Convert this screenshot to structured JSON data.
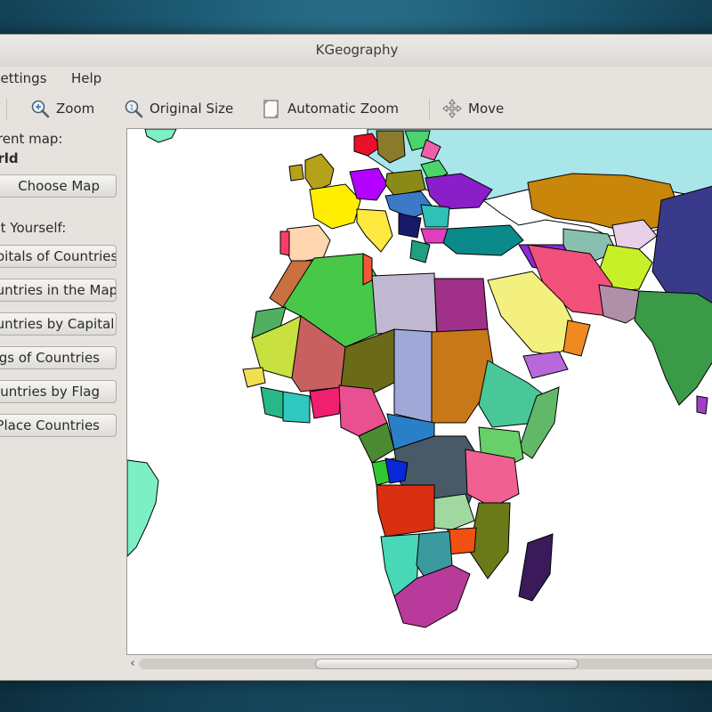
{
  "window": {
    "title": "KGeography"
  },
  "menu": {
    "settings": "Settings",
    "help": "Help"
  },
  "toolbar": {
    "zoom": "Zoom",
    "original_size": "Original Size",
    "automatic_zoom": "Automatic Zoom",
    "move": "Move"
  },
  "sidebar": {
    "current_map_label": "Current map:",
    "current_map_value": "World",
    "choose_map": "Choose Map",
    "test_yourself_label": "Test Yourself:",
    "buttons": [
      "Capitals of Countries",
      "Countries in the Map",
      "Countries by Capital",
      "Flags of Countries",
      "Countries by Flag",
      "Place Countries"
    ]
  },
  "colors": {
    "ocean": "#a8e6ea",
    "land_white": "#ffffff",
    "window_bg": "#e6e3df",
    "desktop": "#1c5a73"
  },
  "icons": [
    "zoom-icon",
    "original-size-icon",
    "automatic-zoom-icon",
    "move-icon",
    "scroll-left-icon"
  ]
}
